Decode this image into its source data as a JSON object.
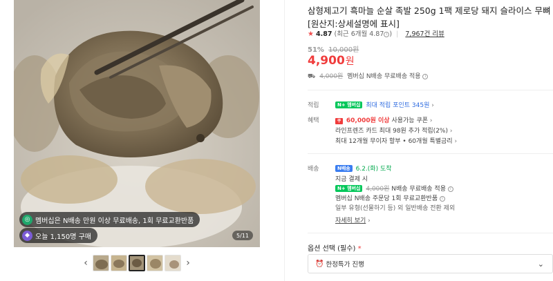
{
  "gallery": {
    "badge_membership": "멤버십은 N배송 만원 이상 무료배송, 1회 무료교환반품",
    "badge_membership_icon": "membership-icon",
    "badge_purchases": "오늘 1,150명 구매",
    "badge_purchases_icon": "fire-icon",
    "page_counter": "5/11",
    "prev_arrow": "‹",
    "next_arrow": "›"
  },
  "product": {
    "title_line1": "삼형제고기 흑마늘 순살 족발 250g 1팩 제로당 돼지 슬라이스 무뼈",
    "title_line2": "[원산지:상세설명에 표시]",
    "rating": "4.87",
    "rating_recent": "(최근 6개월 4.87",
    "rating_recent_close": ")",
    "review_count": "7,967건 리뷰",
    "discount_rate": "51%",
    "original_price": "10,000원",
    "price": "4,900",
    "price_unit": "원",
    "shipping_fee": "4,000원",
    "shipping_text": "멤버십 N배송 무료배송 적용"
  },
  "benefits": {
    "points_label": "적립",
    "points_chip": "N+ 멤버십",
    "points_text": "최대 적립 포인트 345원",
    "perks_label": "혜택",
    "coupon_chip": "쿠",
    "coupon_amount": "60,000원 이상",
    "coupon_text": "사용가능 쿠폰",
    "card_text": "라인프렌즈 카드 최대 98원 추가 적립(2%)",
    "installment_text": "최대 12개월 무이자 할부 • 60개월 특별금리"
  },
  "delivery": {
    "label": "배송",
    "chip": "N배송",
    "date": "6.2.(화) 도착",
    "pay_condition": "지금 결제 시",
    "membership_chip": "N+ 멤버십",
    "fee_strike": "4,000원",
    "fee_text": "N배송 무료배송 적용",
    "return_text": "멤버십 N배송 주문당 1회 무료교환반품",
    "exception_text": "일부 유형(선물하기 등) 외 일반배송 전환 제외",
    "more_link": "자세히 보기"
  },
  "option": {
    "label": "옵션 선택 (필수)",
    "required_mark": "*",
    "selected": "한정특가 진행",
    "selected_icon": "alarm-clock-icon"
  }
}
